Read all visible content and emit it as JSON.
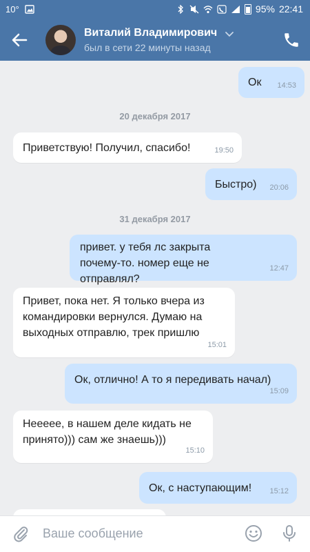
{
  "statusbar": {
    "temp": "10°",
    "battery": "95%",
    "time": "22:41"
  },
  "header": {
    "name": "Виталий Владимирович",
    "status": "был в сети 22 минуты назад"
  },
  "messages": [
    {
      "type": "out",
      "text": "Ок",
      "time": "14:53"
    },
    {
      "type": "date",
      "text": "20 декабря 2017"
    },
    {
      "type": "in",
      "text": "Приветствую! Получил, спасибо!",
      "time": "19:50"
    },
    {
      "type": "out",
      "text": "Быстро)",
      "time": "20:06"
    },
    {
      "type": "date",
      "text": "31 декабря 2017"
    },
    {
      "type": "out",
      "text": "привет. у тебя лс закрыта почему-то. номер еще не отправлял?",
      "time": "12:47"
    },
    {
      "type": "in",
      "text": "Привет, пока нет. Я только вчера из командировки вернулся. Думаю на выходных отправлю, трек пришлю",
      "time": "15:01"
    },
    {
      "type": "out",
      "text": "Ок, отлично! А то я передивать начал)",
      "time": "15:09"
    },
    {
      "type": "in",
      "text": "Нееееe, в нашем деле кидать не принято))) сам же знаешь)))",
      "time": "15:10"
    },
    {
      "type": "out",
      "text": "Ок, с наступающим!",
      "time": "15:12"
    }
  ],
  "composer": {
    "placeholder": "Ваше сообщение"
  },
  "colors": {
    "header": "#4a76a8",
    "outgoing": "#cce4ff",
    "incoming": "#ffffff",
    "background": "#edeef0"
  }
}
